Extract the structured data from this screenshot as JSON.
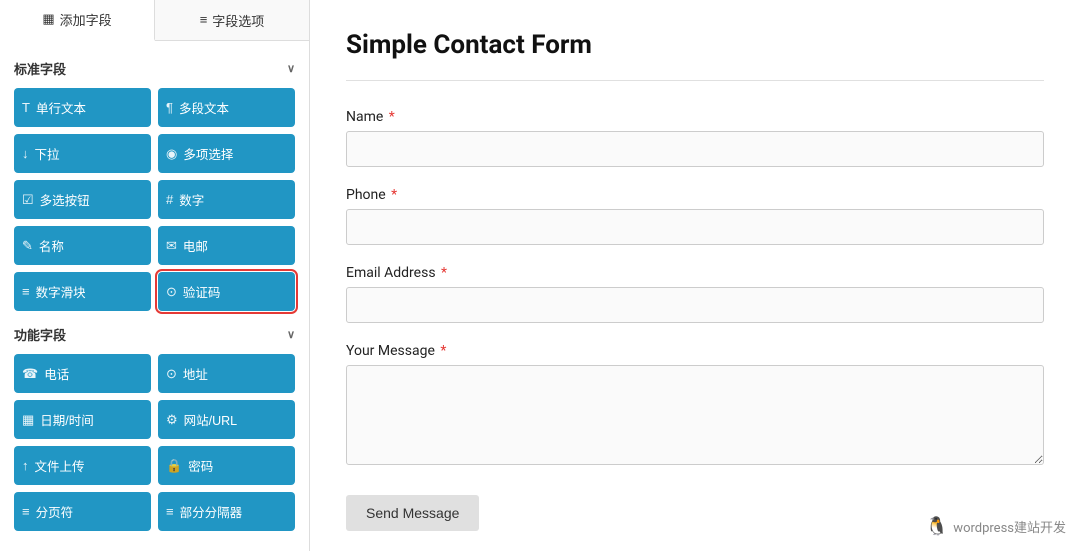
{
  "tabs": [
    {
      "id": "add-field",
      "label": "添加字段",
      "icon": "▦",
      "active": true
    },
    {
      "id": "field-options",
      "label": "字段选项",
      "icon": "≡",
      "active": false
    }
  ],
  "standard_section": {
    "title": "标准字段",
    "fields": [
      {
        "id": "single-text",
        "icon": "T",
        "label": "单行文本",
        "highlighted": false
      },
      {
        "id": "multi-text",
        "icon": "¶",
        "label": "多段文本",
        "highlighted": false
      },
      {
        "id": "dropdown",
        "icon": "↓",
        "label": "下拉",
        "highlighted": false
      },
      {
        "id": "multi-choice",
        "icon": "◉",
        "label": "多项选择",
        "highlighted": false
      },
      {
        "id": "checkbox",
        "icon": "☑",
        "label": "多选按钮",
        "highlighted": false
      },
      {
        "id": "number",
        "icon": "#",
        "label": "数字",
        "highlighted": false
      },
      {
        "id": "name",
        "icon": "✎",
        "label": "名称",
        "highlighted": false
      },
      {
        "id": "email",
        "icon": "✉",
        "label": "电邮",
        "highlighted": false
      },
      {
        "id": "number-slider",
        "icon": "≡",
        "label": "数字滑块",
        "highlighted": false
      },
      {
        "id": "captcha",
        "icon": "⊙",
        "label": "验证码",
        "highlighted": true
      }
    ]
  },
  "functional_section": {
    "title": "功能字段",
    "fields": [
      {
        "id": "phone",
        "icon": "☎",
        "label": "电话",
        "highlighted": false
      },
      {
        "id": "address",
        "icon": "⊙",
        "label": "地址",
        "highlighted": false
      },
      {
        "id": "datetime",
        "icon": "▦",
        "label": "日期/时间",
        "highlighted": false
      },
      {
        "id": "website",
        "icon": "⚙",
        "label": "网站/URL",
        "highlighted": false
      },
      {
        "id": "file-upload",
        "icon": "↑",
        "label": "文件上传",
        "highlighted": false
      },
      {
        "id": "password",
        "icon": "🔒",
        "label": "密码",
        "highlighted": false
      },
      {
        "id": "page-break",
        "icon": "≡",
        "label": "分页符",
        "highlighted": false
      },
      {
        "id": "section-divider",
        "icon": "≡",
        "label": "部分分隔器",
        "highlighted": false
      }
    ]
  },
  "form": {
    "title": "Simple Contact Form",
    "fields": [
      {
        "id": "name",
        "label": "Name",
        "type": "input",
        "required": true
      },
      {
        "id": "phone",
        "label": "Phone",
        "type": "input",
        "required": true
      },
      {
        "id": "email",
        "label": "Email Address",
        "type": "input",
        "required": true
      },
      {
        "id": "message",
        "label": "Your Message",
        "type": "textarea",
        "required": true
      }
    ],
    "submit_label": "Send Message"
  },
  "watermark": {
    "text": "wordpress建站开发"
  }
}
